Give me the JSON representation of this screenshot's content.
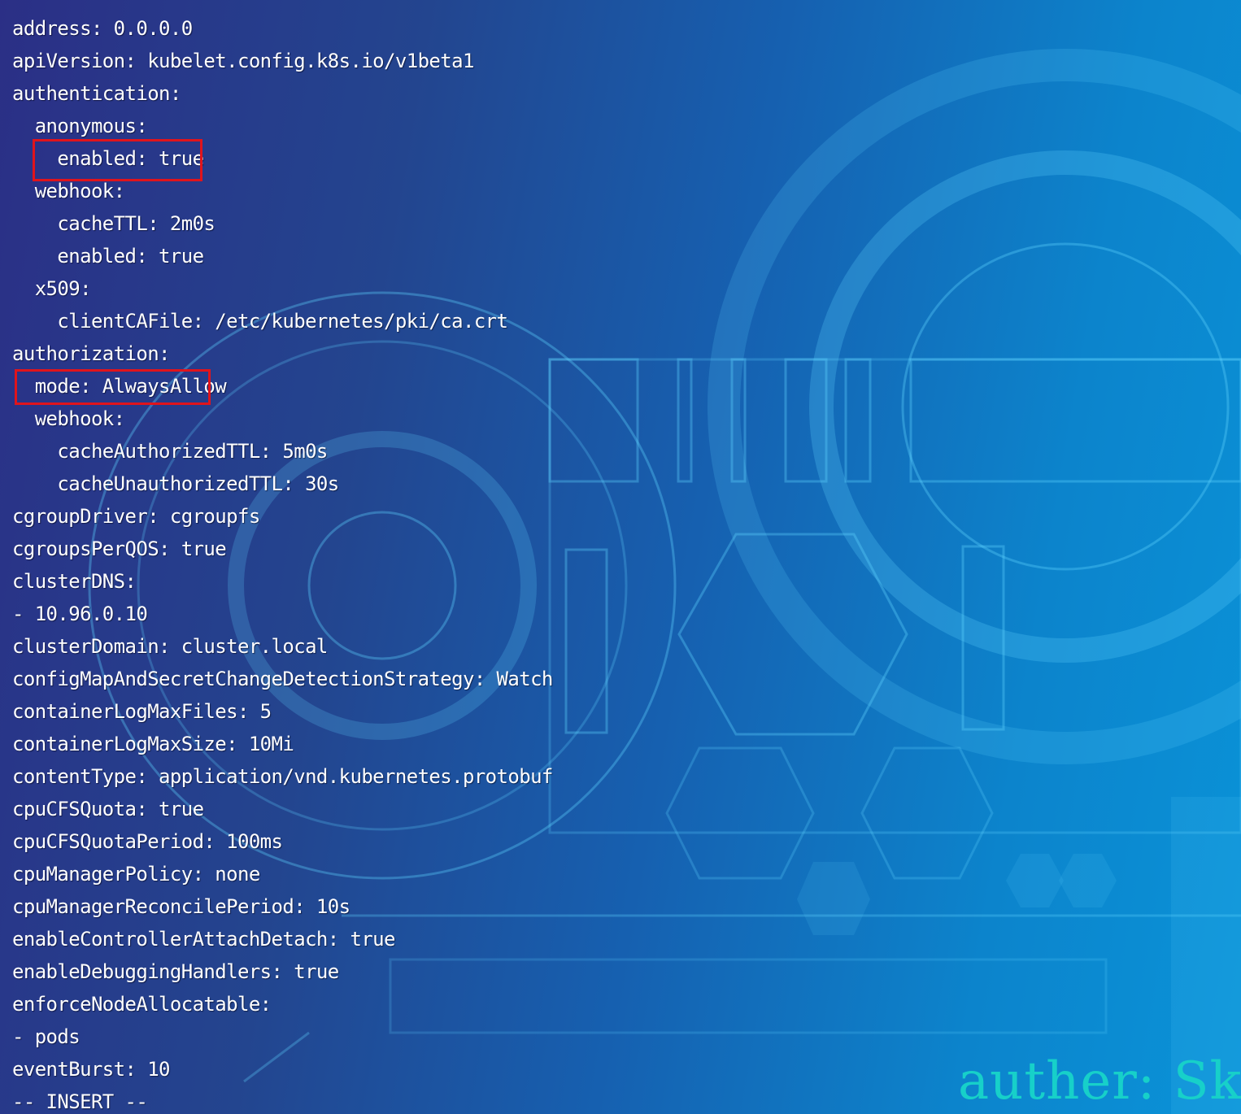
{
  "editor": {
    "lines": [
      "address: 0.0.0.0",
      "apiVersion: kubelet.config.k8s.io/v1beta1",
      "authentication:",
      "  anonymous:",
      "    enabled: true",
      "  webhook:",
      "    cacheTTL: 2m0s",
      "    enabled: true",
      "  x509:",
      "    clientCAFile: /etc/kubernetes/pki/ca.crt",
      "authorization:",
      "  mode: AlwaysAllow",
      "  webhook:",
      "    cacheAuthorizedTTL: 5m0s",
      "    cacheUnauthorizedTTL: 30s",
      "cgroupDriver: cgroupfs",
      "cgroupsPerQOS: true",
      "clusterDNS:",
      "- 10.96.0.10",
      "clusterDomain: cluster.local",
      "configMapAndSecretChangeDetectionStrategy: Watch",
      "containerLogMaxFiles: 5",
      "containerLogMaxSize: 10Mi",
      "contentType: application/vnd.kubernetes.protobuf",
      "cpuCFSQuota: true",
      "cpuCFSQuotaPeriod: 100ms",
      "cpuManagerPolicy: none",
      "cpuManagerReconcilePeriod: 10s",
      "enableControllerAttachDetach: true",
      "enableDebuggingHandlers: true",
      "enforceNodeAllocatable:",
      "- pods",
      "eventBurst: 10"
    ],
    "highlighted_line_indices": [
      4,
      11
    ],
    "status": "-- INSERT --"
  },
  "watermark": {
    "text": "auther: Ske"
  },
  "colors": {
    "text": "#ffffff",
    "highlight_border": "#e0141c",
    "watermark": "#17d0c9",
    "background_left": "#2b2f86",
    "background_right": "#0a93d8"
  }
}
